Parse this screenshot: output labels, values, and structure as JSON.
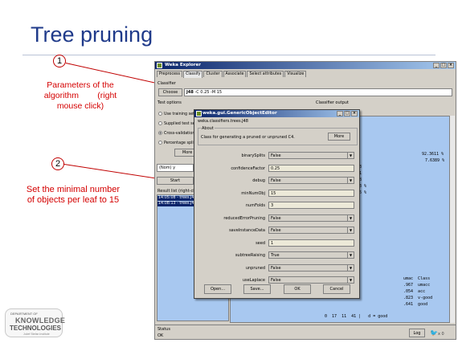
{
  "slide": {
    "title": "Tree pruning",
    "callout1": {
      "number": "1",
      "text_lines": [
        "Parameters of the",
        "algorithm        (right",
        "mouse click)"
      ]
    },
    "callout2": {
      "number": "2",
      "text_lines": [
        "Set the minimal number",
        "of objects per leaf to 15"
      ]
    },
    "logo": {
      "line1": "DEPARTMENT OF",
      "line2": "KNOWLEDGE",
      "line3": "TECHNOLOGIES",
      "line4": "Jožef Stefan Institute"
    },
    "accent_color": "#1f3a8a",
    "callout_color": "#d40000"
  },
  "explorer": {
    "title": "Weka Explorer",
    "tabs": [
      "Preprocess",
      "Classify",
      "Cluster",
      "Associate",
      "Select attributes",
      "Visualize"
    ],
    "active_tab": "Classify",
    "classifier_label": "Classifier",
    "choose_label": "Choose",
    "classifier_name": "J48",
    "classifier_options": "-C 0.25 -M 15",
    "test_options_label": "Test options",
    "classifier_output_label": "Classifier output",
    "radios": [
      "Use training set",
      "Supplied test se",
      "Cross-validation",
      "Percentage split"
    ],
    "selected_radio": 2,
    "more_options_label": "More op",
    "class_selector": "(Nom) y",
    "start_label": "Start",
    "result_list_label": "Result list (right-click",
    "results": [
      "14:05:08 - trees.J4",
      "14:08:13 - trees.J4"
    ],
    "output_right": [
      "92.3611 %",
      "7.6389 %"
    ],
    "output_mid": [
      "343",
      "821",
      "718",
      "333 %",
      "276 %"
    ],
    "output_table": [
      "umac  Class",
      ".967  umacc",
      ".054  acc",
      ".823  v-good",
      ".641  good"
    ],
    "output_matrix": "0  17  11  41 |   d = good",
    "status_label": "Status",
    "status_text": "OK",
    "log_label": "Log",
    "bird_suffix": "x 0"
  },
  "dialog": {
    "title": "weka.gui.GenericObjectEditor",
    "class_path": "weka.classifiers.trees.J48",
    "about_label": "About",
    "about_text": "Class for generating a pruned or unpruned C4.",
    "more_label": "More",
    "params": [
      {
        "name": "binarySplits",
        "value": "False",
        "kind": "select"
      },
      {
        "name": "confidenceFactor",
        "value": "0.25",
        "kind": "text"
      },
      {
        "name": "debug",
        "value": "False",
        "kind": "select"
      },
      {
        "name": "minNumObj",
        "value": "15",
        "kind": "text"
      },
      {
        "name": "numFolds",
        "value": "3",
        "kind": "text"
      },
      {
        "name": "reducedErrorPruning",
        "value": "False",
        "kind": "select"
      },
      {
        "name": "saveInstanceData",
        "value": "False",
        "kind": "select"
      },
      {
        "name": "seed",
        "value": "1",
        "kind": "text"
      },
      {
        "name": "subtreeRaising",
        "value": "True",
        "kind": "select"
      },
      {
        "name": "unpruned",
        "value": "False",
        "kind": "select"
      },
      {
        "name": "useLaplace",
        "value": "False",
        "kind": "select"
      }
    ],
    "buttons": [
      "Open...",
      "Save...",
      "OK",
      "Cancel"
    ]
  }
}
